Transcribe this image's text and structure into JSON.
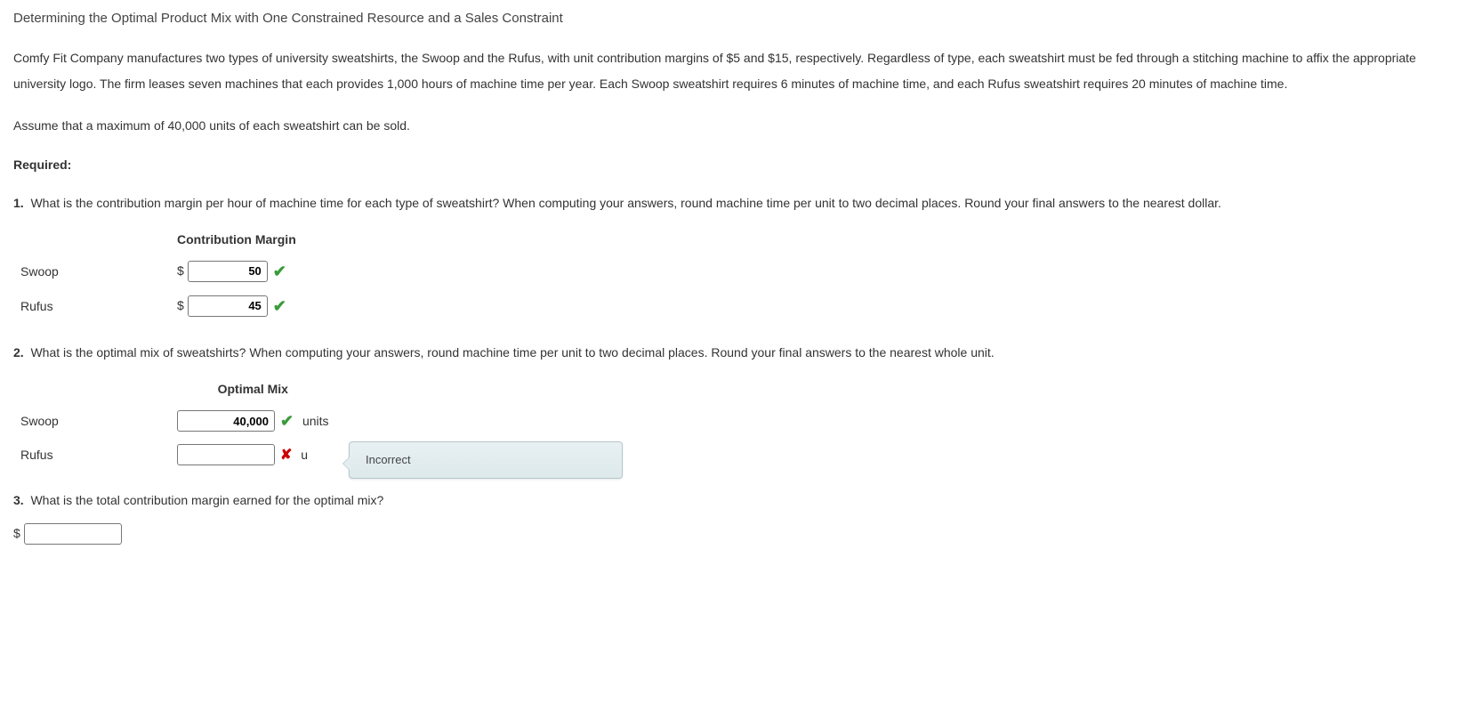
{
  "title": "Determining the Optimal Product Mix with One Constrained Resource and a Sales Constraint",
  "description": "Comfy Fit Company manufactures two types of university sweatshirts, the Swoop and the Rufus, with unit contribution margins of $5 and $15, respectively. Regardless of type, each sweatshirt must be fed through a stitching machine to affix the appropriate university logo. The firm leases seven machines that each provides 1,000 hours of machine time per year. Each Swoop sweatshirt requires 6 minutes of machine time, and each Rufus sweatshirt requires 20 minutes of machine time.",
  "assumption": "Assume that a maximum of 40,000 units of each sweatshirt can be sold.",
  "required_label": "Required:",
  "q1": {
    "num": "1.",
    "text": "What is the contribution margin per hour of machine time for each type of sweatshirt? When computing your answers, round machine time per unit to two decimal places. Round your final answers to the nearest dollar.",
    "header": "Contribution Margin",
    "rows": [
      {
        "label": "Swoop",
        "prefix": "$",
        "value": "50",
        "status": "correct"
      },
      {
        "label": "Rufus",
        "prefix": "$",
        "value": "45",
        "status": "correct"
      }
    ]
  },
  "q2": {
    "num": "2.",
    "text": "What is the optimal mix of sweatshirts? When computing your answers, round machine time per unit to two decimal places. Round your final answers to the nearest whole unit.",
    "header": "Optimal Mix",
    "rows": [
      {
        "label": "Swoop",
        "value": "40,000",
        "status": "correct",
        "suffix": "units"
      },
      {
        "label": "Rufus",
        "value": "",
        "status": "incorrect",
        "suffix": "u",
        "tooltip": "Incorrect"
      }
    ]
  },
  "q3": {
    "num": "3.",
    "text": "What is the total contribution margin earned for the optimal mix?",
    "prefix": "$",
    "value": ""
  }
}
